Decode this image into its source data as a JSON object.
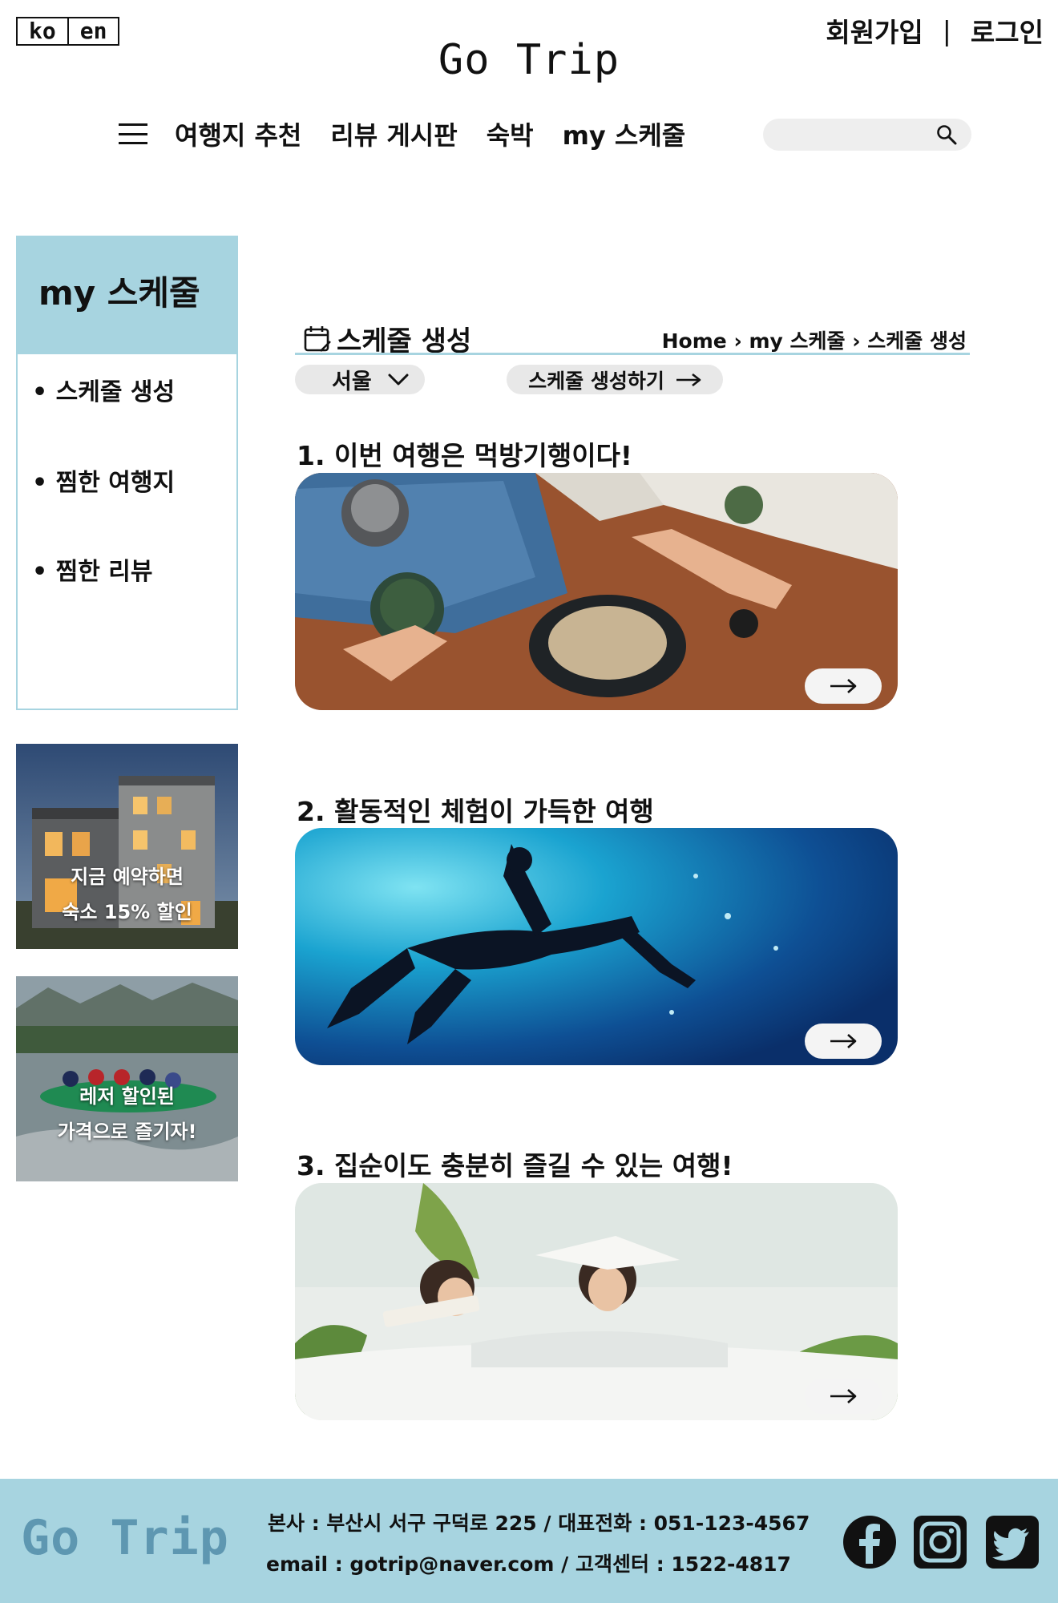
{
  "header": {
    "lang": {
      "ko": "ko",
      "en": "en"
    },
    "signup": "회원가입",
    "separator": "|",
    "login": "로그인",
    "logo": "Go Trip"
  },
  "nav": {
    "items": [
      "여행지 추천",
      "리뷰 게시판",
      "숙박",
      "my 스케줄"
    ],
    "search_placeholder": ""
  },
  "sidebar": {
    "title": "my 스케줄",
    "items": [
      "• 스케줄 생성",
      "• 찜한 여행지",
      "• 찜한 리뷰"
    ],
    "banners": [
      {
        "line1": "지금 예약하면",
        "line2": "숙소 15% 할인"
      },
      {
        "line1": "레저 할인된",
        "line2": "가격으로 즐기자!"
      }
    ]
  },
  "main": {
    "section_title": "스케줄 생성",
    "breadcrumb": [
      "Home",
      "my 스케줄",
      "스케줄 생성"
    ],
    "breadcrumb_sep": "›",
    "city_select": "서울",
    "create_button": "스케줄 생성하기",
    "plans": [
      {
        "title": "1. 이번 여행은 먹방기행이다!"
      },
      {
        "title": "2. 활동적인 체험이 가득한 여행"
      },
      {
        "title": "3. 집순이도 충분히 즐길 수 있는 여행!"
      }
    ]
  },
  "footer": {
    "logo": "Go Trip",
    "address": "본사 : 부산시 서구 구덕로 225 / 대표전화 : 051-123-4567",
    "contact": "email : gotrip@naver.com / 고객센터 : 1522-4817"
  },
  "colors": {
    "accent": "#a7d4e0",
    "footer_logo": "#5e97b1",
    "pill": "#e8e8e8"
  },
  "icons": [
    "menu-icon",
    "search-icon",
    "chevron-down-icon",
    "arrow-right-icon",
    "calendar-icon",
    "facebook-icon",
    "instagram-icon",
    "twitter-icon"
  ]
}
